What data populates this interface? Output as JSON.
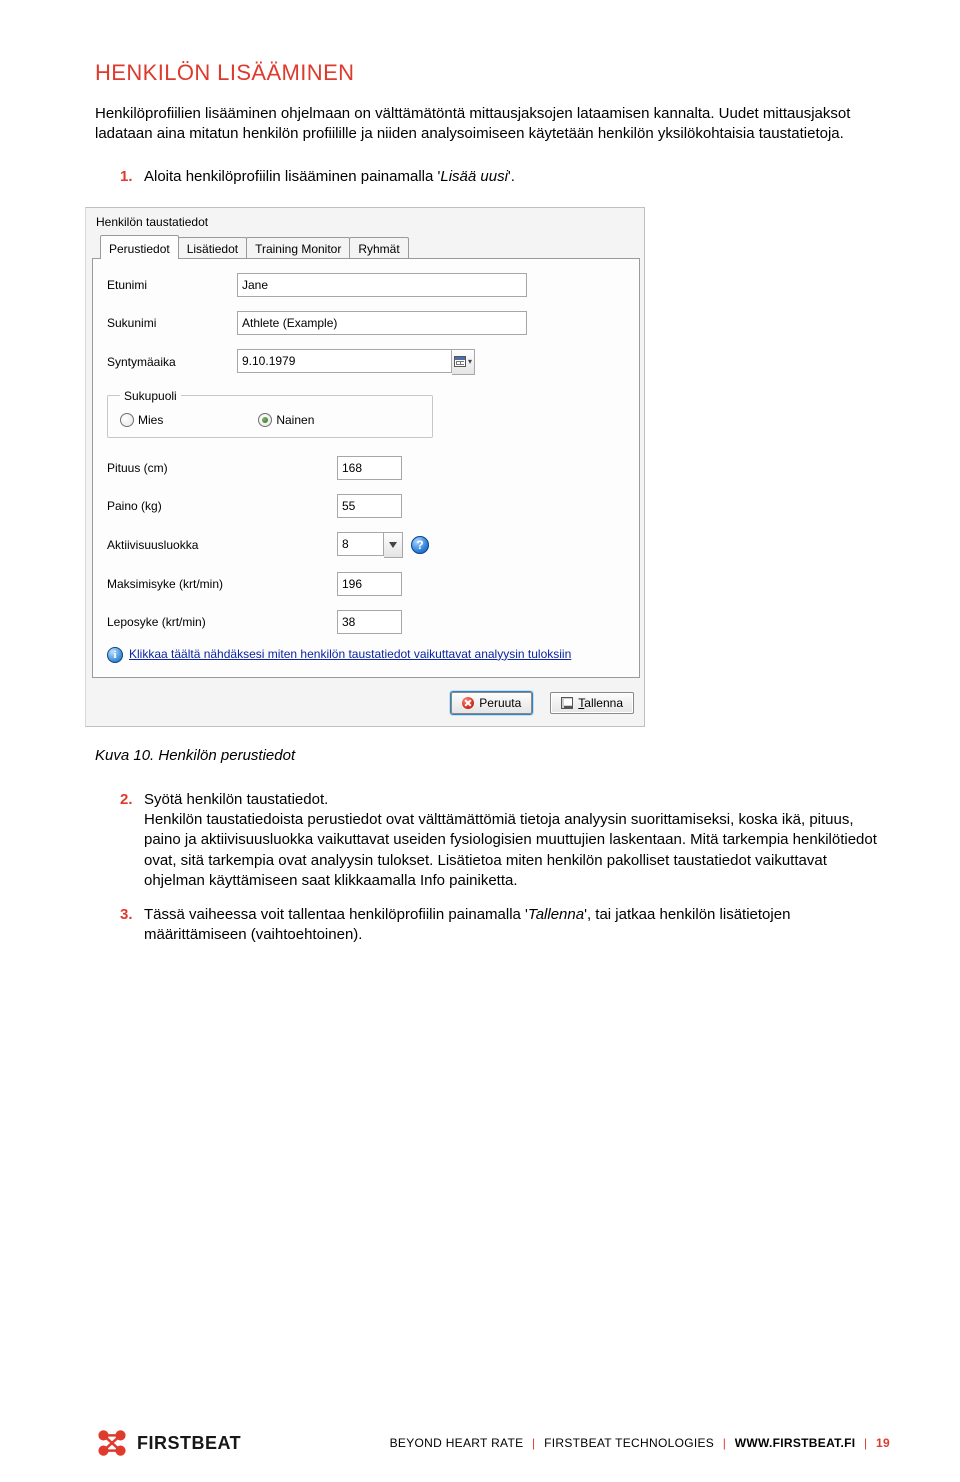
{
  "heading": "HENKILÖN LISÄÄMINEN",
  "intro": "Henkilöprofiilien lisääminen ohjelmaan on välttämätöntä mittausjaksojen lataamisen kannalta. Uudet mittausjaksot ladataan aina mitatun henkilön profiilille ja niiden analysoimiseen käytetään henkilön yksilökohtaisia taustatietoja.",
  "step1_text": "Aloita henkilöprofiilin lisääminen painamalla '",
  "step1_btn": "Lisää uusi",
  "step1_tail": "'.",
  "dialog": {
    "title": "Henkilön taustatiedot",
    "tabs": [
      "Perustiedot",
      "Lisätiedot",
      "Training Monitor",
      "Ryhmät"
    ],
    "fields": {
      "firstname_label": "Etunimi",
      "firstname": "Jane",
      "lastname_label": "Sukunimi",
      "lastname": "Athlete (Example)",
      "dob_label": "Syntymäaika",
      "dob": "9.10.1979",
      "gender_legend": "Sukupuoli",
      "gender_male": "Mies",
      "gender_female": "Nainen",
      "height_label": "Pituus (cm)",
      "height": "168",
      "weight_label": "Paino (kg)",
      "weight": "55",
      "activity_label": "Aktiivisuusluokka",
      "activity": "8",
      "hrmax_label": "Maksimisyke (krt/min)",
      "hrmax": "196",
      "hrrest_label": "Leposyke (krt/min)",
      "hrrest": "38"
    },
    "info_link": "Klikkaa täältä nähdäksesi miten henkilön taustatiedot vaikuttavat analyysin tuloksiin",
    "buttons": {
      "cancel": "Peruuta",
      "save_prefix": "T",
      "save_rest": "allenna"
    }
  },
  "caption": "Kuva 10. Henkilön perustiedot",
  "step2_bold": "Syötä henkilön taustatiedot.",
  "step2_body": "Henkilön taustatiedoista perustiedot ovat välttämättömiä tietoja analyysin suorittamiseksi, koska ikä, pituus, paino ja aktiivisuusluokka vaikuttavat useiden fysiologisien muuttujien laskentaan. Mitä tarkempia henkilötiedot ovat, sitä tarkempia ovat analyysin tulokset. Lisätietoa miten henkilön pakolliset taustatiedot vaikuttavat ohjelman käyttämiseen saat klikkaamalla Info painiketta.",
  "step3_pre": "Tässä vaiheessa voit tallentaa henkilöprofiilin painamalla '",
  "step3_btn": "Tallenna",
  "step3_post": "', tai jatkaa henkilön lisätietojen määrittämiseen (vaihtoehtoinen).",
  "footer": {
    "slogan": "BEYOND HEART RATE",
    "company": "FIRSTBEAT TECHNOLOGIES",
    "url": "WWW.FIRSTBEAT.FI",
    "page": "19",
    "logo_word": "FIRSTBEAT"
  }
}
